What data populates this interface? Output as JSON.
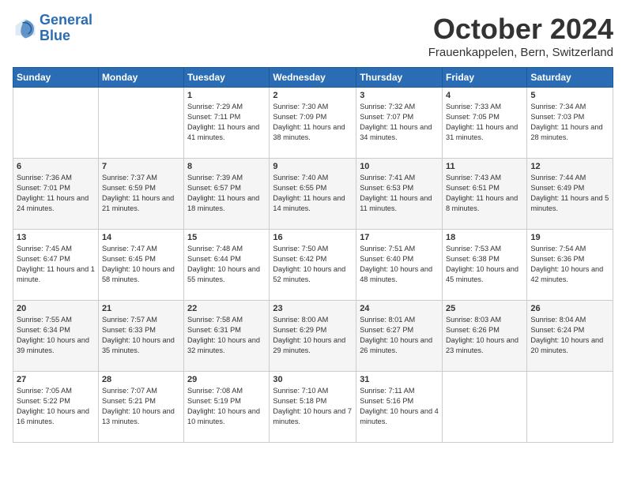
{
  "header": {
    "logo_line1": "General",
    "logo_line2": "Blue",
    "title": "October 2024",
    "location": "Frauenkappelen, Bern, Switzerland"
  },
  "weekdays": [
    "Sunday",
    "Monday",
    "Tuesday",
    "Wednesday",
    "Thursday",
    "Friday",
    "Saturday"
  ],
  "weeks": [
    [
      {
        "day": null
      },
      {
        "day": null
      },
      {
        "day": "1",
        "sunrise": "Sunrise: 7:29 AM",
        "sunset": "Sunset: 7:11 PM",
        "daylight": "Daylight: 11 hours and 41 minutes."
      },
      {
        "day": "2",
        "sunrise": "Sunrise: 7:30 AM",
        "sunset": "Sunset: 7:09 PM",
        "daylight": "Daylight: 11 hours and 38 minutes."
      },
      {
        "day": "3",
        "sunrise": "Sunrise: 7:32 AM",
        "sunset": "Sunset: 7:07 PM",
        "daylight": "Daylight: 11 hours and 34 minutes."
      },
      {
        "day": "4",
        "sunrise": "Sunrise: 7:33 AM",
        "sunset": "Sunset: 7:05 PM",
        "daylight": "Daylight: 11 hours and 31 minutes."
      },
      {
        "day": "5",
        "sunrise": "Sunrise: 7:34 AM",
        "sunset": "Sunset: 7:03 PM",
        "daylight": "Daylight: 11 hours and 28 minutes."
      }
    ],
    [
      {
        "day": "6",
        "sunrise": "Sunrise: 7:36 AM",
        "sunset": "Sunset: 7:01 PM",
        "daylight": "Daylight: 11 hours and 24 minutes."
      },
      {
        "day": "7",
        "sunrise": "Sunrise: 7:37 AM",
        "sunset": "Sunset: 6:59 PM",
        "daylight": "Daylight: 11 hours and 21 minutes."
      },
      {
        "day": "8",
        "sunrise": "Sunrise: 7:39 AM",
        "sunset": "Sunset: 6:57 PM",
        "daylight": "Daylight: 11 hours and 18 minutes."
      },
      {
        "day": "9",
        "sunrise": "Sunrise: 7:40 AM",
        "sunset": "Sunset: 6:55 PM",
        "daylight": "Daylight: 11 hours and 14 minutes."
      },
      {
        "day": "10",
        "sunrise": "Sunrise: 7:41 AM",
        "sunset": "Sunset: 6:53 PM",
        "daylight": "Daylight: 11 hours and 11 minutes."
      },
      {
        "day": "11",
        "sunrise": "Sunrise: 7:43 AM",
        "sunset": "Sunset: 6:51 PM",
        "daylight": "Daylight: 11 hours and 8 minutes."
      },
      {
        "day": "12",
        "sunrise": "Sunrise: 7:44 AM",
        "sunset": "Sunset: 6:49 PM",
        "daylight": "Daylight: 11 hours and 5 minutes."
      }
    ],
    [
      {
        "day": "13",
        "sunrise": "Sunrise: 7:45 AM",
        "sunset": "Sunset: 6:47 PM",
        "daylight": "Daylight: 11 hours and 1 minute."
      },
      {
        "day": "14",
        "sunrise": "Sunrise: 7:47 AM",
        "sunset": "Sunset: 6:45 PM",
        "daylight": "Daylight: 10 hours and 58 minutes."
      },
      {
        "day": "15",
        "sunrise": "Sunrise: 7:48 AM",
        "sunset": "Sunset: 6:44 PM",
        "daylight": "Daylight: 10 hours and 55 minutes."
      },
      {
        "day": "16",
        "sunrise": "Sunrise: 7:50 AM",
        "sunset": "Sunset: 6:42 PM",
        "daylight": "Daylight: 10 hours and 52 minutes."
      },
      {
        "day": "17",
        "sunrise": "Sunrise: 7:51 AM",
        "sunset": "Sunset: 6:40 PM",
        "daylight": "Daylight: 10 hours and 48 minutes."
      },
      {
        "day": "18",
        "sunrise": "Sunrise: 7:53 AM",
        "sunset": "Sunset: 6:38 PM",
        "daylight": "Daylight: 10 hours and 45 minutes."
      },
      {
        "day": "19",
        "sunrise": "Sunrise: 7:54 AM",
        "sunset": "Sunset: 6:36 PM",
        "daylight": "Daylight: 10 hours and 42 minutes."
      }
    ],
    [
      {
        "day": "20",
        "sunrise": "Sunrise: 7:55 AM",
        "sunset": "Sunset: 6:34 PM",
        "daylight": "Daylight: 10 hours and 39 minutes."
      },
      {
        "day": "21",
        "sunrise": "Sunrise: 7:57 AM",
        "sunset": "Sunset: 6:33 PM",
        "daylight": "Daylight: 10 hours and 35 minutes."
      },
      {
        "day": "22",
        "sunrise": "Sunrise: 7:58 AM",
        "sunset": "Sunset: 6:31 PM",
        "daylight": "Daylight: 10 hours and 32 minutes."
      },
      {
        "day": "23",
        "sunrise": "Sunrise: 8:00 AM",
        "sunset": "Sunset: 6:29 PM",
        "daylight": "Daylight: 10 hours and 29 minutes."
      },
      {
        "day": "24",
        "sunrise": "Sunrise: 8:01 AM",
        "sunset": "Sunset: 6:27 PM",
        "daylight": "Daylight: 10 hours and 26 minutes."
      },
      {
        "day": "25",
        "sunrise": "Sunrise: 8:03 AM",
        "sunset": "Sunset: 6:26 PM",
        "daylight": "Daylight: 10 hours and 23 minutes."
      },
      {
        "day": "26",
        "sunrise": "Sunrise: 8:04 AM",
        "sunset": "Sunset: 6:24 PM",
        "daylight": "Daylight: 10 hours and 20 minutes."
      }
    ],
    [
      {
        "day": "27",
        "sunrise": "Sunrise: 7:05 AM",
        "sunset": "Sunset: 5:22 PM",
        "daylight": "Daylight: 10 hours and 16 minutes."
      },
      {
        "day": "28",
        "sunrise": "Sunrise: 7:07 AM",
        "sunset": "Sunset: 5:21 PM",
        "daylight": "Daylight: 10 hours and 13 minutes."
      },
      {
        "day": "29",
        "sunrise": "Sunrise: 7:08 AM",
        "sunset": "Sunset: 5:19 PM",
        "daylight": "Daylight: 10 hours and 10 minutes."
      },
      {
        "day": "30",
        "sunrise": "Sunrise: 7:10 AM",
        "sunset": "Sunset: 5:18 PM",
        "daylight": "Daylight: 10 hours and 7 minutes."
      },
      {
        "day": "31",
        "sunrise": "Sunrise: 7:11 AM",
        "sunset": "Sunset: 5:16 PM",
        "daylight": "Daylight: 10 hours and 4 minutes."
      },
      {
        "day": null
      },
      {
        "day": null
      }
    ]
  ]
}
